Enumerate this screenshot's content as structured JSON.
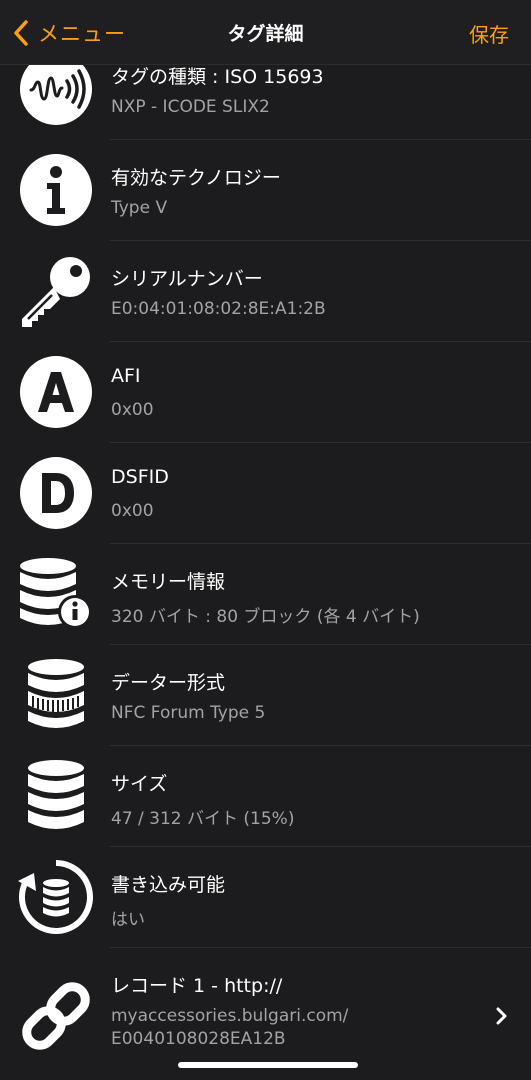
{
  "nav": {
    "back_label": "メニュー",
    "title": "タグ詳細",
    "save_label": "保存",
    "accent_color": "#ff9f0a"
  },
  "rows": [
    {
      "icon": "nfc-tag-icon",
      "title": "タグの種類 : ISO 15693",
      "subtitle": "NXP - ICODE SLIX2"
    },
    {
      "icon": "info-icon",
      "title": "有効なテクノロジー",
      "subtitle": "Type V"
    },
    {
      "icon": "key-icon",
      "title": "シリアルナンバー",
      "subtitle": "E0:04:01:08:02:8E:A1:2B"
    },
    {
      "icon": "letter-a-icon",
      "title": "AFI",
      "subtitle": "0x00"
    },
    {
      "icon": "letter-d-icon",
      "title": "DSFID",
      "subtitle": "0x00"
    },
    {
      "icon": "database-info-icon",
      "title": "メモリー情報",
      "subtitle": "320 バイト : 80 ブロック (各 4 バイト)"
    },
    {
      "icon": "database-format-icon",
      "title": "データー形式",
      "subtitle": "NFC Forum Type 5"
    },
    {
      "icon": "database-size-icon",
      "title": "サイズ",
      "subtitle": "47 / 312 バイト (15%)"
    },
    {
      "icon": "database-write-icon",
      "title": "書き込み可能",
      "subtitle": "はい"
    },
    {
      "icon": "link-icon",
      "title": "レコード 1 - http://",
      "subtitle": "myaccessories.bulgari.com/",
      "subtitle2": "E0040108028EA12B"
    }
  ]
}
